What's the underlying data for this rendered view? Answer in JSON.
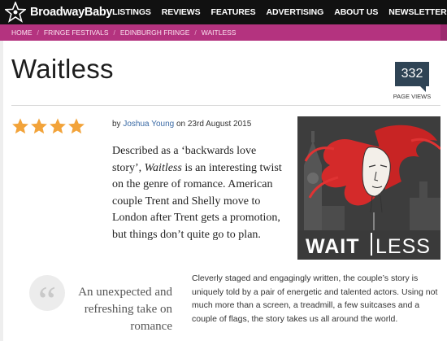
{
  "brand": {
    "name": "BroadwayBaby"
  },
  "nav": {
    "items": [
      "LISTINGS",
      "REVIEWS",
      "FEATURES",
      "ADVERTISING",
      "ABOUT US",
      "NEWSLETTER"
    ]
  },
  "breadcrumb": [
    "HOME",
    "FRINGE FESTIVALS",
    "EDINBURGH FRINGE",
    "WAITLESS"
  ],
  "breadcrumb_separator": "/",
  "article": {
    "title": "Waitless",
    "page_views": "332",
    "page_views_label": "PAGE VIEWS",
    "rating_stars": 4,
    "byline_prefix": "by",
    "author": "Joshua Young",
    "date_text": "on 23rd August 2015",
    "intro_before": "Described as a ‘backwards love story’, ",
    "intro_italic": "Waitless",
    "intro_after": " is an interesting twist on the genre of romance. American couple Trent and Shelly move to London after Trent gets a promotion, but things don’t quite go to plan.",
    "poster_title_bold": "WAIT",
    "poster_title_light": "LESS",
    "quote_glyph": "“",
    "pull_quote": "An unexpected and refreshing take on romance",
    "body": "Cleverly staged and engagingly written, the couple’s story is uniquely told by a pair of energetic and talented actors. Using not much more than a screen, a treadmill, a few suitcases and a couple of flags, the story takes us all around the world."
  },
  "colors": {
    "nav_bg": "#111111",
    "breadcrumb_bg": "#b4337f",
    "views_bg": "#2f4455",
    "star": "#f2a33a",
    "author_link": "#3a6aa5"
  }
}
